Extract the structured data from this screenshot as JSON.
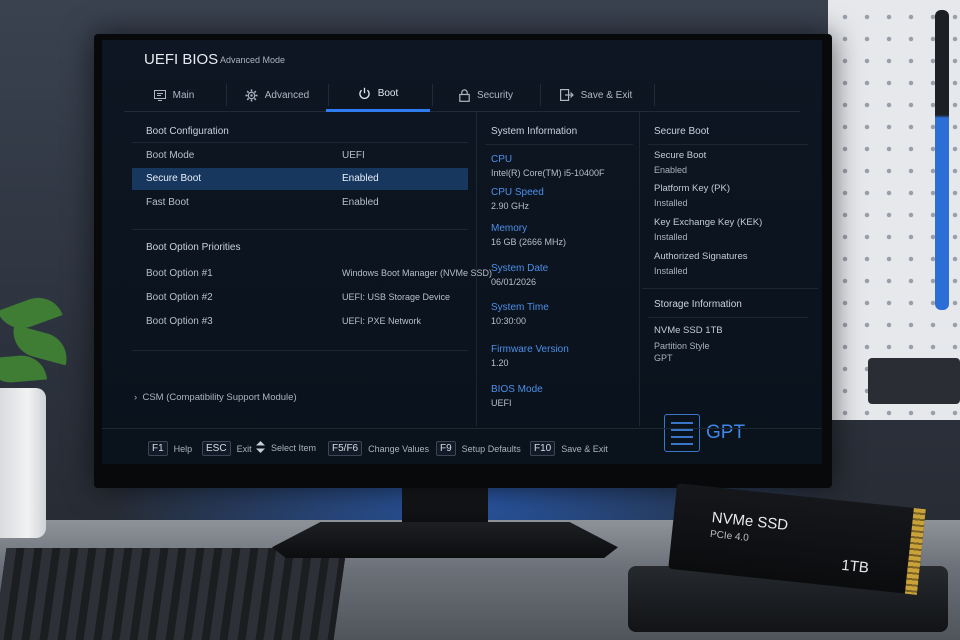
{
  "bios": {
    "title": "UEFI BIOS",
    "mode": "Advanced Mode"
  },
  "tabs": [
    {
      "label": "Main",
      "icon": "monitor-icon"
    },
    {
      "label": "Advanced",
      "icon": "gear-icon"
    },
    {
      "label": "Boot",
      "icon": "power-icon",
      "active": true
    },
    {
      "label": "Security",
      "icon": "lock-icon"
    },
    {
      "label": "Save & Exit",
      "icon": "exit-icon"
    }
  ],
  "boot_config": {
    "heading": "Boot Configuration",
    "rows": [
      {
        "label": "Boot Mode",
        "value": "UEFI"
      },
      {
        "label": "Secure Boot",
        "value": "Enabled",
        "selected": true
      },
      {
        "label": "Fast Boot",
        "value": "Enabled"
      }
    ]
  },
  "boot_priorities": {
    "heading": "Boot Option Priorities",
    "rows": [
      {
        "label": "Boot Option #1",
        "value": "Windows Boot Manager (NVMe SSD)"
      },
      {
        "label": "Boot Option #2",
        "value": "UEFI: USB Storage Device"
      },
      {
        "label": "Boot Option #3",
        "value": "UEFI: PXE Network"
      }
    ]
  },
  "csm": "CSM (Compatibility Support Module)",
  "system_info": {
    "heading": "System Information",
    "items": [
      {
        "key": "CPU",
        "value": "Intel(R) Core(TM) i5-10400F"
      },
      {
        "key": "CPU Speed",
        "value": "2.90 GHz"
      },
      {
        "key": "Memory",
        "value": "16 GB (2666 MHz)"
      },
      {
        "key": "System Date",
        "value": "06/01/2026"
      },
      {
        "key": "System Time",
        "value": "10:30:00"
      },
      {
        "key": "Firmware Version",
        "value": "1.20"
      },
      {
        "key": "BIOS Mode",
        "value": "UEFI"
      }
    ]
  },
  "secure_boot": {
    "heading": "Secure Boot",
    "items": [
      {
        "key": "Secure Boot",
        "value": "Enabled"
      },
      {
        "key": "Platform Key (PK)",
        "value": "Installed"
      },
      {
        "key": "Key Exchange Key (KEK)",
        "value": "Installed"
      },
      {
        "key": "Authorized Signatures",
        "value": "Installed"
      }
    ]
  },
  "storage": {
    "heading": "Storage Information",
    "device": "NVMe SSD 1TB",
    "partition_label": "Partition Style",
    "partition_value": "GPT",
    "badge": "GPT"
  },
  "footer": [
    {
      "key": "F1",
      "label": "Help"
    },
    {
      "key": "ESC",
      "label": "Exit"
    },
    {
      "key": "",
      "label": "Select Item",
      "icon": "updown-arrow-icon"
    },
    {
      "key": "F5/F6",
      "label": "Change Values"
    },
    {
      "key": "F9",
      "label": "Setup Defaults"
    },
    {
      "key": "F10",
      "label": "Save & Exit"
    }
  ],
  "ssd_prop": {
    "title": "NVMe SSD",
    "subtitle": "PCIe 4.0",
    "capacity": "1TB"
  },
  "colors": {
    "accent": "#2f7cf0",
    "selection": "#17375f",
    "info_key": "#4d8fe8",
    "screen_bg": "#0b141f"
  }
}
